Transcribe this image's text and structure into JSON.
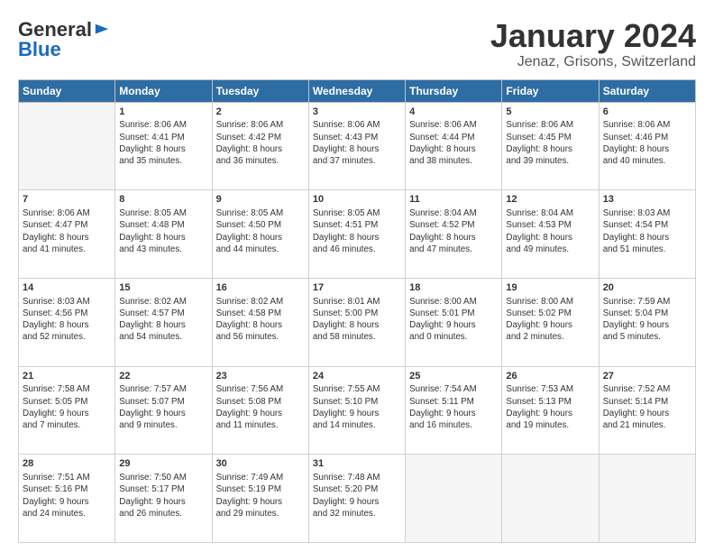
{
  "logo": {
    "general": "General",
    "blue": "Blue"
  },
  "title": "January 2024",
  "location": "Jenaz, Grisons, Switzerland",
  "weekdays": [
    "Sunday",
    "Monday",
    "Tuesday",
    "Wednesday",
    "Thursday",
    "Friday",
    "Saturday"
  ],
  "days": [
    {
      "date": "",
      "info": ""
    },
    {
      "date": "1",
      "info": "Sunrise: 8:06 AM\nSunset: 4:41 PM\nDaylight: 8 hours\nand 35 minutes."
    },
    {
      "date": "2",
      "info": "Sunrise: 8:06 AM\nSunset: 4:42 PM\nDaylight: 8 hours\nand 36 minutes."
    },
    {
      "date": "3",
      "info": "Sunrise: 8:06 AM\nSunset: 4:43 PM\nDaylight: 8 hours\nand 37 minutes."
    },
    {
      "date": "4",
      "info": "Sunrise: 8:06 AM\nSunset: 4:44 PM\nDaylight: 8 hours\nand 38 minutes."
    },
    {
      "date": "5",
      "info": "Sunrise: 8:06 AM\nSunset: 4:45 PM\nDaylight: 8 hours\nand 39 minutes."
    },
    {
      "date": "6",
      "info": "Sunrise: 8:06 AM\nSunset: 4:46 PM\nDaylight: 8 hours\nand 40 minutes."
    },
    {
      "date": "7",
      "info": "Sunrise: 8:06 AM\nSunset: 4:47 PM\nDaylight: 8 hours\nand 41 minutes."
    },
    {
      "date": "8",
      "info": "Sunrise: 8:05 AM\nSunset: 4:48 PM\nDaylight: 8 hours\nand 43 minutes."
    },
    {
      "date": "9",
      "info": "Sunrise: 8:05 AM\nSunset: 4:50 PM\nDaylight: 8 hours\nand 44 minutes."
    },
    {
      "date": "10",
      "info": "Sunrise: 8:05 AM\nSunset: 4:51 PM\nDaylight: 8 hours\nand 46 minutes."
    },
    {
      "date": "11",
      "info": "Sunrise: 8:04 AM\nSunset: 4:52 PM\nDaylight: 8 hours\nand 47 minutes."
    },
    {
      "date": "12",
      "info": "Sunrise: 8:04 AM\nSunset: 4:53 PM\nDaylight: 8 hours\nand 49 minutes."
    },
    {
      "date": "13",
      "info": "Sunrise: 8:03 AM\nSunset: 4:54 PM\nDaylight: 8 hours\nand 51 minutes."
    },
    {
      "date": "14",
      "info": "Sunrise: 8:03 AM\nSunset: 4:56 PM\nDaylight: 8 hours\nand 52 minutes."
    },
    {
      "date": "15",
      "info": "Sunrise: 8:02 AM\nSunset: 4:57 PM\nDaylight: 8 hours\nand 54 minutes."
    },
    {
      "date": "16",
      "info": "Sunrise: 8:02 AM\nSunset: 4:58 PM\nDaylight: 8 hours\nand 56 minutes."
    },
    {
      "date": "17",
      "info": "Sunrise: 8:01 AM\nSunset: 5:00 PM\nDaylight: 8 hours\nand 58 minutes."
    },
    {
      "date": "18",
      "info": "Sunrise: 8:00 AM\nSunset: 5:01 PM\nDaylight: 9 hours\nand 0 minutes."
    },
    {
      "date": "19",
      "info": "Sunrise: 8:00 AM\nSunset: 5:02 PM\nDaylight: 9 hours\nand 2 minutes."
    },
    {
      "date": "20",
      "info": "Sunrise: 7:59 AM\nSunset: 5:04 PM\nDaylight: 9 hours\nand 5 minutes."
    },
    {
      "date": "21",
      "info": "Sunrise: 7:58 AM\nSunset: 5:05 PM\nDaylight: 9 hours\nand 7 minutes."
    },
    {
      "date": "22",
      "info": "Sunrise: 7:57 AM\nSunset: 5:07 PM\nDaylight: 9 hours\nand 9 minutes."
    },
    {
      "date": "23",
      "info": "Sunrise: 7:56 AM\nSunset: 5:08 PM\nDaylight: 9 hours\nand 11 minutes."
    },
    {
      "date": "24",
      "info": "Sunrise: 7:55 AM\nSunset: 5:10 PM\nDaylight: 9 hours\nand 14 minutes."
    },
    {
      "date": "25",
      "info": "Sunrise: 7:54 AM\nSunset: 5:11 PM\nDaylight: 9 hours\nand 16 minutes."
    },
    {
      "date": "26",
      "info": "Sunrise: 7:53 AM\nSunset: 5:13 PM\nDaylight: 9 hours\nand 19 minutes."
    },
    {
      "date": "27",
      "info": "Sunrise: 7:52 AM\nSunset: 5:14 PM\nDaylight: 9 hours\nand 21 minutes."
    },
    {
      "date": "28",
      "info": "Sunrise: 7:51 AM\nSunset: 5:16 PM\nDaylight: 9 hours\nand 24 minutes."
    },
    {
      "date": "29",
      "info": "Sunrise: 7:50 AM\nSunset: 5:17 PM\nDaylight: 9 hours\nand 26 minutes."
    },
    {
      "date": "30",
      "info": "Sunrise: 7:49 AM\nSunset: 5:19 PM\nDaylight: 9 hours\nand 29 minutes."
    },
    {
      "date": "31",
      "info": "Sunrise: 7:48 AM\nSunset: 5:20 PM\nDaylight: 9 hours\nand 32 minutes."
    },
    {
      "date": "",
      "info": ""
    },
    {
      "date": "",
      "info": ""
    },
    {
      "date": "",
      "info": ""
    }
  ]
}
